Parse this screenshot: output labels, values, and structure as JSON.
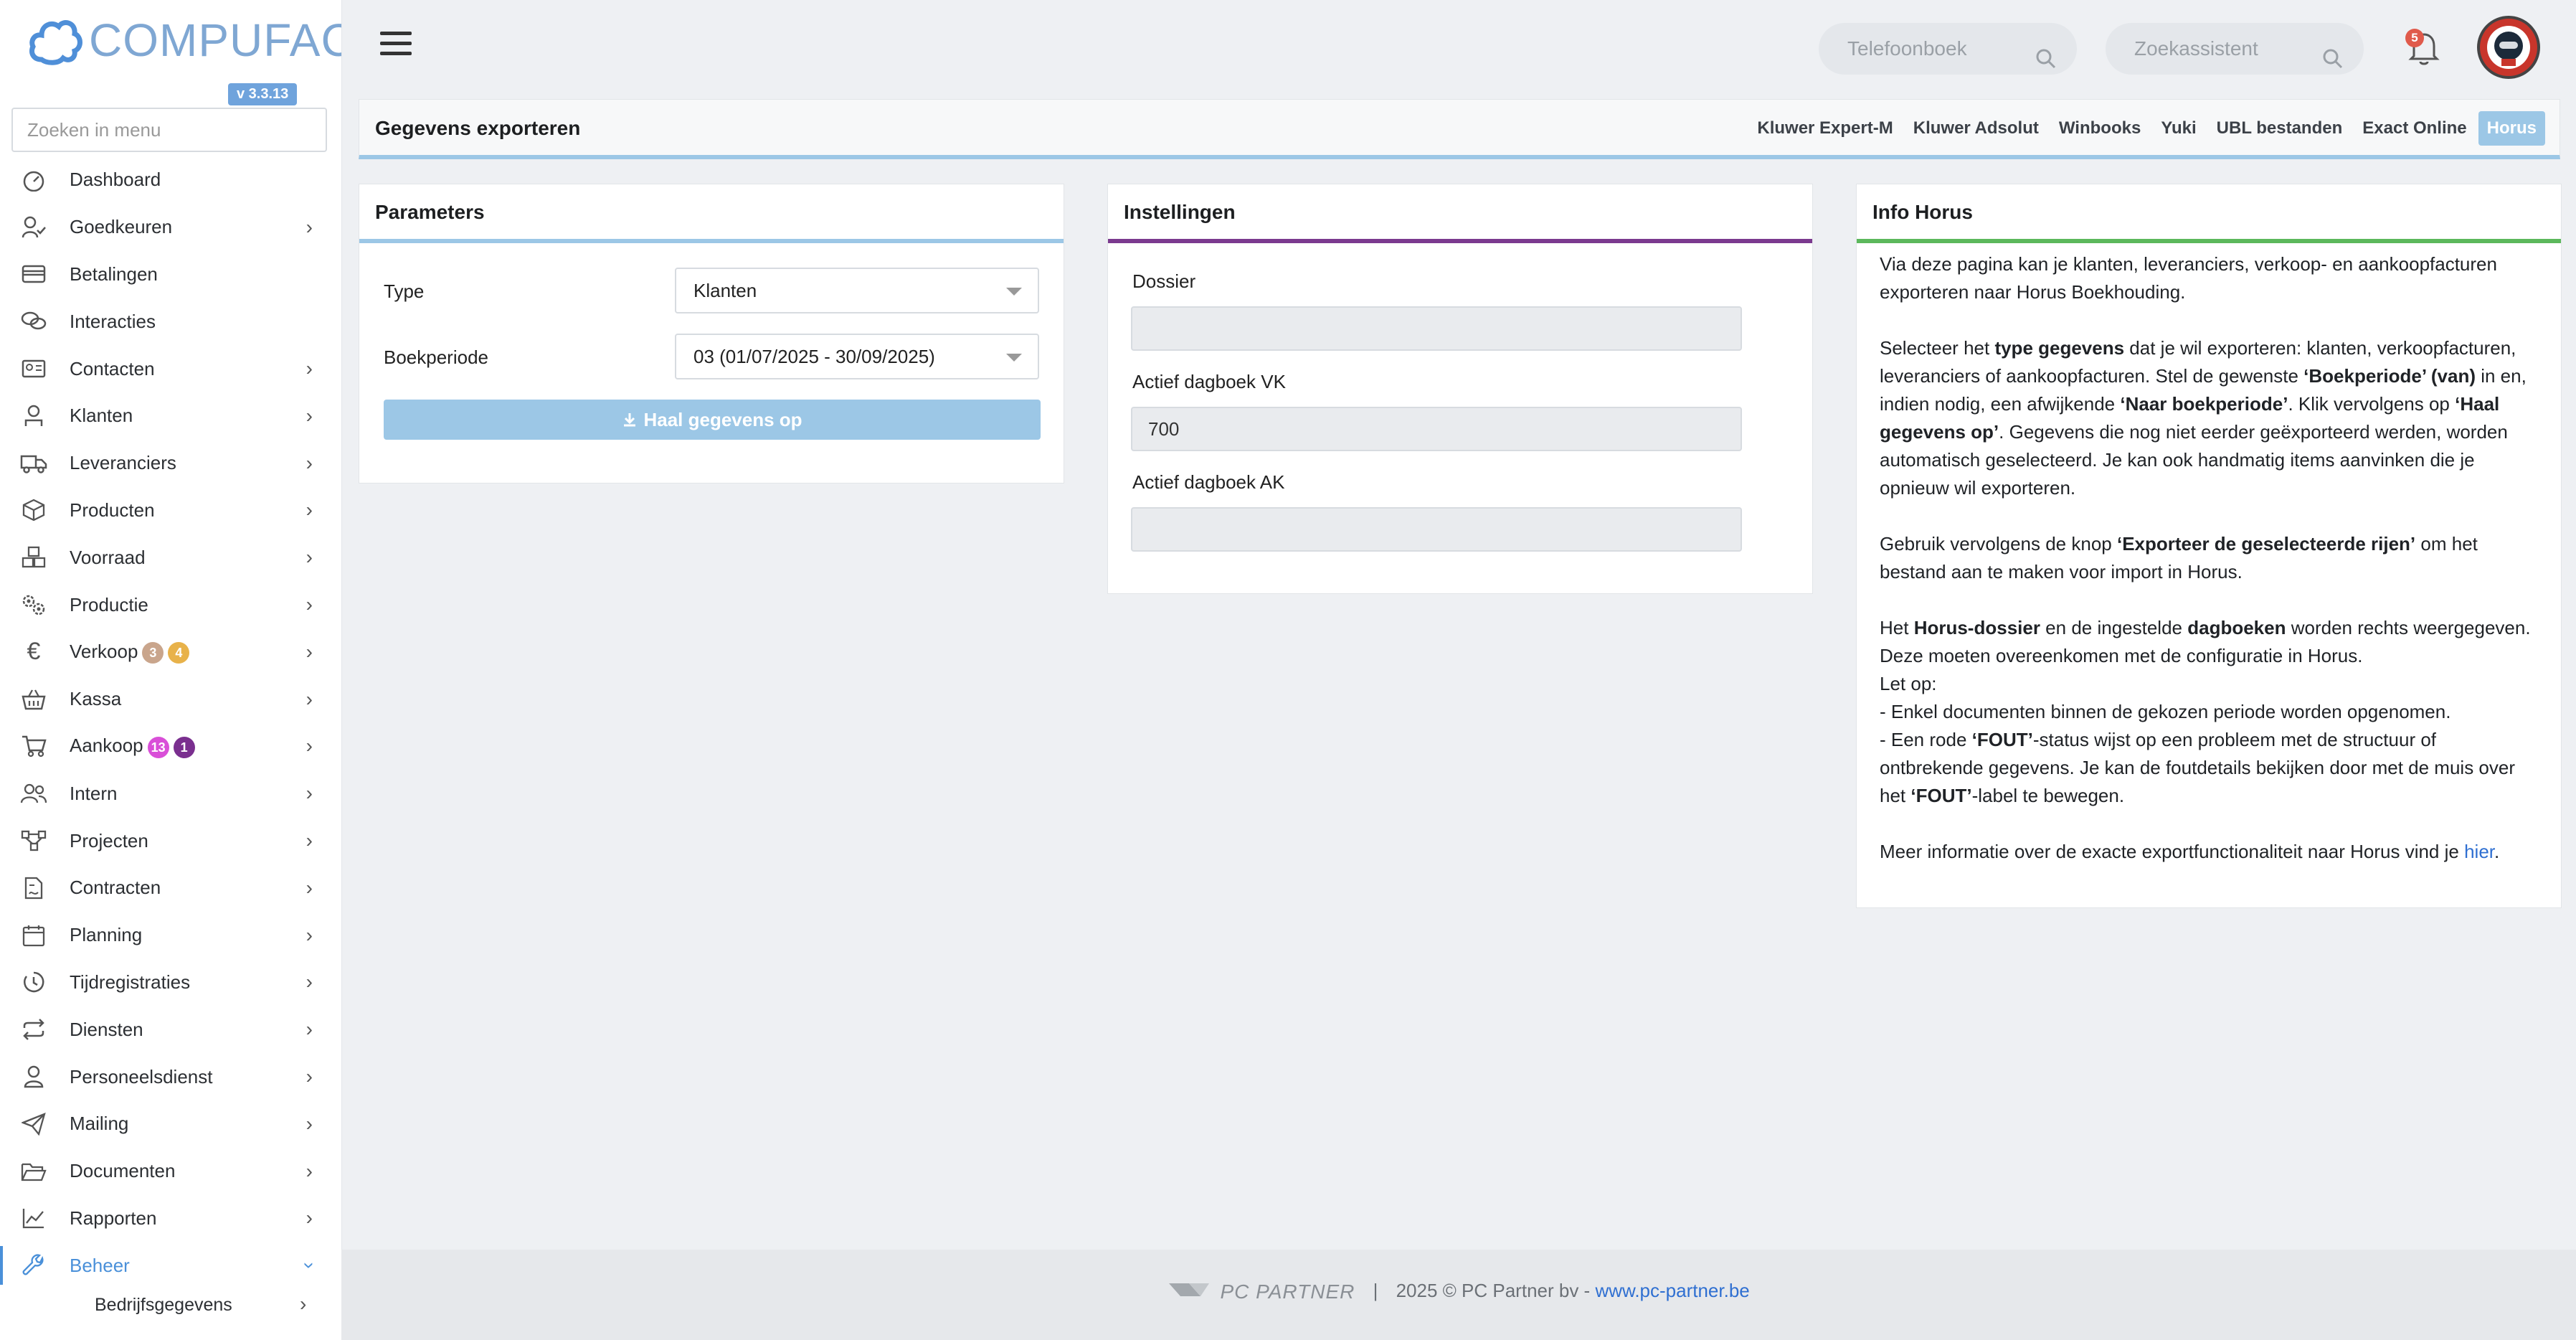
{
  "app": {
    "logo_text": "COMPUFACT",
    "version": "v 3.3.13",
    "menu_search_placeholder": "Zoeken in menu"
  },
  "sidebar": {
    "items": [
      {
        "label": "Dashboard",
        "icon": "dashboard-icon",
        "has_children": false
      },
      {
        "label": "Goedkeuren",
        "icon": "user-check-icon",
        "has_children": true
      },
      {
        "label": "Betalingen",
        "icon": "credit-card-icon",
        "has_children": false
      },
      {
        "label": "Interacties",
        "icon": "chat-bubbles-icon",
        "has_children": false
      },
      {
        "label": "Contacten",
        "icon": "contact-card-icon",
        "has_children": true
      },
      {
        "label": "Klanten",
        "icon": "customer-icon",
        "has_children": true
      },
      {
        "label": "Leveranciers",
        "icon": "truck-icon",
        "has_children": true
      },
      {
        "label": "Producten",
        "icon": "box-icon",
        "has_children": true
      },
      {
        "label": "Voorraad",
        "icon": "boxes-icon",
        "has_children": true
      },
      {
        "label": "Productie",
        "icon": "gears-icon",
        "has_children": true
      },
      {
        "label": "Verkoop",
        "icon": "euro-icon",
        "has_children": true,
        "badges": [
          {
            "text": "3",
            "color": "#c9a58c"
          },
          {
            "text": "4",
            "color": "#e8b24a"
          }
        ]
      },
      {
        "label": "Kassa",
        "icon": "basket-icon",
        "has_children": true
      },
      {
        "label": "Aankoop",
        "icon": "cart-icon",
        "has_children": true,
        "badges": [
          {
            "text": "13",
            "color": "#d94fd8"
          },
          {
            "text": "1",
            "color": "#7a2f8f"
          }
        ]
      },
      {
        "label": "Intern",
        "icon": "users-icon",
        "has_children": true
      },
      {
        "label": "Projecten",
        "icon": "project-nodes-icon",
        "has_children": true
      },
      {
        "label": "Contracten",
        "icon": "contract-icon",
        "has_children": true
      },
      {
        "label": "Planning",
        "icon": "calendar-icon",
        "has_children": true
      },
      {
        "label": "Tijdregistraties",
        "icon": "clock-icon",
        "has_children": true
      },
      {
        "label": "Diensten",
        "icon": "repeat-icon",
        "has_children": true
      },
      {
        "label": "Personeelsdienst",
        "icon": "staff-icon",
        "has_children": true
      },
      {
        "label": "Mailing",
        "icon": "paper-plane-icon",
        "has_children": true
      },
      {
        "label": "Documenten",
        "icon": "folder-icon",
        "has_children": true
      },
      {
        "label": "Rapporten",
        "icon": "line-chart-icon",
        "has_children": true
      },
      {
        "label": "Beheer",
        "icon": "wrench-icon",
        "has_children": true,
        "active": true,
        "expanded": true
      }
    ],
    "sub_item": "Bedrijfsgegevens"
  },
  "topbar": {
    "phonebook_placeholder": "Telefoonboek",
    "assistant_placeholder": "Zoekassistent",
    "notifications_count": "5"
  },
  "page": {
    "title": "Gegevens exporteren",
    "export_tabs": [
      "Kluwer Expert-M",
      "Kluwer Adsolut",
      "Winbooks",
      "Yuki",
      "UBL bestanden",
      "Exact Online",
      "Horus"
    ],
    "active_tab": "Horus"
  },
  "parameters": {
    "title": "Parameters",
    "type_label": "Type",
    "type_value": "Klanten",
    "period_label": "Boekperiode",
    "period_value": "03 (01/07/2025 - 30/09/2025)",
    "fetch_button": "Haal gegevens op"
  },
  "settings": {
    "title": "Instellingen",
    "dossier_label": "Dossier",
    "dossier_value": "",
    "vk_label": "Actief dagboek VK",
    "vk_value": "700",
    "ak_label": "Actief dagboek AK",
    "ak_value": ""
  },
  "info": {
    "title": "Info Horus",
    "link_text": "hier"
  },
  "footer": {
    "brand": "PC PARTNER",
    "separator": "|",
    "copyright": "2025 © PC Partner bv - ",
    "link": "www.pc-partner.be"
  },
  "colors": {
    "accent_blue": "#9cc7e6",
    "settings_accent": "#7b3a8f",
    "info_accent": "#5cb85c",
    "active_menu": "#4a90d9"
  }
}
